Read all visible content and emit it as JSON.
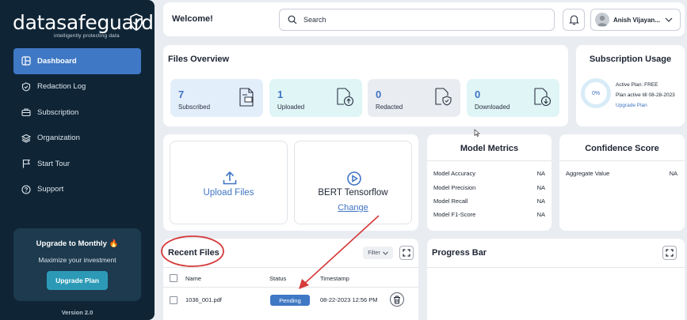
{
  "brand": {
    "name": "datasafeguard",
    "tagline": "intelligently protecting data"
  },
  "sidebar": {
    "items": [
      {
        "label": "Dashboard",
        "icon": "dashboard-icon",
        "active": true
      },
      {
        "label": "Redaction Log",
        "icon": "shield-check-icon",
        "active": false
      },
      {
        "label": "Subscription",
        "icon": "briefcase-icon",
        "active": false
      },
      {
        "label": "Organization",
        "icon": "layers-icon",
        "active": false
      },
      {
        "label": "Start Tour",
        "icon": "flag-icon",
        "active": false
      },
      {
        "label": "Support",
        "icon": "help-circle-icon",
        "active": false
      }
    ],
    "upgrade": {
      "title": "Upgrade to Monthly 🔥",
      "subtitle": "Maximize your investment",
      "button": "Upgrade Plan"
    },
    "version": "Version 2.0"
  },
  "header": {
    "welcome": "Welcome!",
    "search_label": "Search",
    "user_name": "Anish Vijayan..."
  },
  "files_overview": {
    "title": "Files Overview",
    "stats": [
      {
        "value": "7",
        "label": "Subscribed",
        "icon": "document-icon",
        "color": "#e3eefb"
      },
      {
        "value": "1",
        "label": "Uploaded",
        "icon": "file-upload-icon",
        "color": "#dff5f6"
      },
      {
        "value": "0",
        "label": "Redacted",
        "icon": "file-shield-icon",
        "color": "#e9ecf1"
      },
      {
        "value": "0",
        "label": "Downloaded",
        "icon": "file-download-icon",
        "color": "#dff5f6"
      }
    ]
  },
  "subscription_usage": {
    "title": "Subscription Usage",
    "percent": "0%",
    "active_plan": "Active Plan: FREE",
    "plan_active_till": "Plan active till  08-28-2023",
    "upgrade_link": "Upgrade Plan"
  },
  "upload": {
    "upload_label": "Upload Files",
    "model_name": "BERT Tensorflow",
    "change_link": "Change"
  },
  "model_metrics": {
    "title": "Model Metrics",
    "rows": [
      {
        "label": "Model Accuracy",
        "value": "NA"
      },
      {
        "label": "Model Precision",
        "value": "NA"
      },
      {
        "label": "Model Recall",
        "value": "NA"
      },
      {
        "label": "Model F1-Score",
        "value": "NA"
      }
    ]
  },
  "confidence_score": {
    "title": "Confidence Score",
    "rows": [
      {
        "label": "Aggregate Value",
        "value": "NA"
      }
    ]
  },
  "recent_files": {
    "title": "Recent Files",
    "filter_label": "Filter",
    "columns": [
      "Name",
      "Status",
      "Timestamp"
    ],
    "rows": [
      {
        "name": "1036_001.pdf",
        "status": "Pending",
        "timestamp": "08-22-2023 12:56 PM"
      }
    ]
  },
  "progress_bar": {
    "title": "Progress Bar"
  },
  "colors": {
    "sidebar_bg": "#0f2536",
    "accent": "#3f78c4",
    "annotation_red": "#d63a3a"
  }
}
